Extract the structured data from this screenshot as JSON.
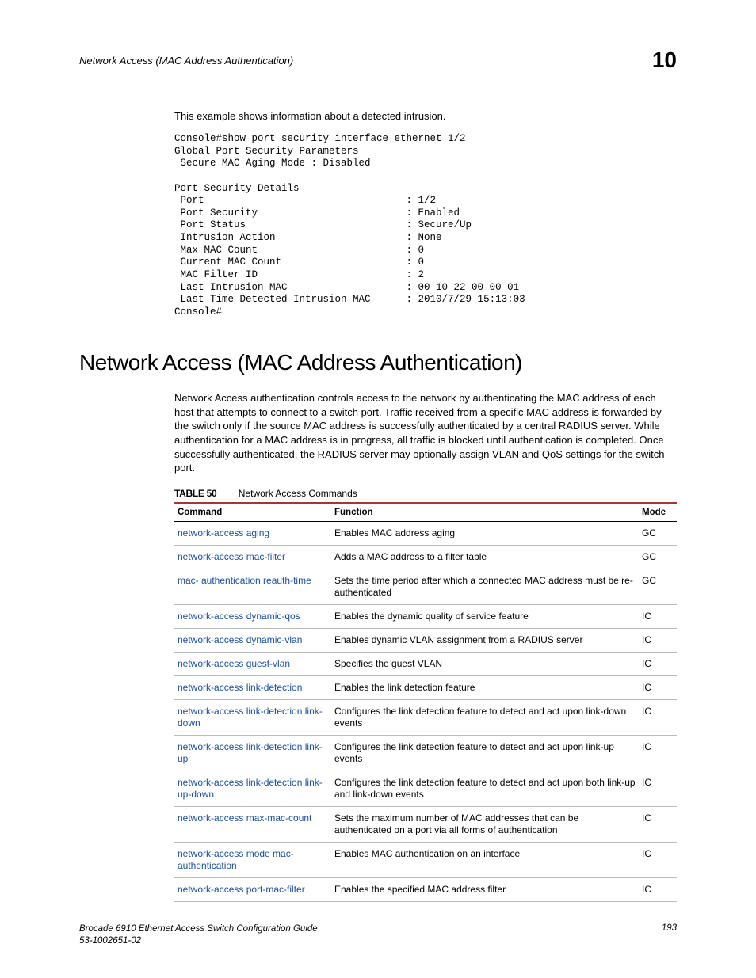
{
  "header": {
    "running_head": "Network Access (MAC Address Authentication)",
    "chapter_number": "10"
  },
  "example_intro": "This example shows information about a detected intrusion.",
  "console_output": "Console#show port security interface ethernet 1/2\nGlobal Port Security Parameters\n Secure MAC Aging Mode : Disabled\n\nPort Security Details\n Port                                  : 1/2\n Port Security                         : Enabled\n Port Status                           : Secure/Up\n Intrusion Action                      : None\n Max MAC Count                         : 0\n Current MAC Count                     : 0\n MAC Filter ID                         : 2\n Last Intrusion MAC                    : 00-10-22-00-00-01\n Last Time Detected Intrusion MAC      : 2010/7/29 15:13:03\nConsole#",
  "section_heading": "Network Access (MAC Address Authentication)",
  "section_body": "Network Access authentication controls access to the network by authenticating the MAC address of each host that attempts to connect to a switch port. Traffic received from a specific MAC address is forwarded by the switch only if the source MAC address is successfully authenticated by a central RADIUS server. While authentication for a MAC address is in progress, all traffic is blocked until authentication is completed. Once successfully authenticated, the RADIUS server may optionally assign VLAN and QoS settings for the switch port.",
  "table": {
    "label": "TABLE 50",
    "caption": "Network Access Commands",
    "headers": {
      "command": "Command",
      "function": "Function",
      "mode": "Mode"
    },
    "rows": [
      {
        "command": "network-access aging",
        "function": "Enables MAC address aging",
        "mode": "GC"
      },
      {
        "command": "network-access mac-filter",
        "function": "Adds a MAC address to a filter table",
        "mode": "GC"
      },
      {
        "command": "mac- authentication reauth-time",
        "function": "Sets the time period after which a connected MAC address must be re-authenticated",
        "mode": "GC"
      },
      {
        "command": "network-access dynamic-qos",
        "function": "Enables the dynamic quality of service feature",
        "mode": "IC"
      },
      {
        "command": "network-access dynamic-vlan",
        "function": "Enables dynamic VLAN assignment from a RADIUS server",
        "mode": "IC"
      },
      {
        "command": "network-access guest-vlan",
        "function": "Specifies the guest VLAN",
        "mode": "IC"
      },
      {
        "command": "network-access link-detection",
        "function": "Enables the link detection feature",
        "mode": "IC"
      },
      {
        "command": "network-access link-detection link-down",
        "function": "Configures the link detection feature to detect and act upon link-down events",
        "mode": "IC"
      },
      {
        "command": "network-access link-detection link-up",
        "function": "Configures the link detection feature to detect and act upon link-up events",
        "mode": "IC"
      },
      {
        "command": "network-access link-detection link-up-down",
        "function": "Configures the link detection feature to detect and act upon both link-up and link-down events",
        "mode": "IC"
      },
      {
        "command": "network-access max-mac-count",
        "function": "Sets the maximum number of MAC addresses that can be authenticated on a port via all forms of authentication",
        "mode": "IC"
      },
      {
        "command": "network-access mode mac-authentication",
        "function": "Enables MAC authentication on an interface",
        "mode": "IC"
      },
      {
        "command": "network-access port-mac-filter",
        "function": "Enables the specified MAC address filter",
        "mode": "IC"
      }
    ]
  },
  "footer": {
    "doc_title": "Brocade 6910 Ethernet Access Switch Configuration Guide",
    "doc_number": "53-1002651-02",
    "page_number": "193"
  }
}
